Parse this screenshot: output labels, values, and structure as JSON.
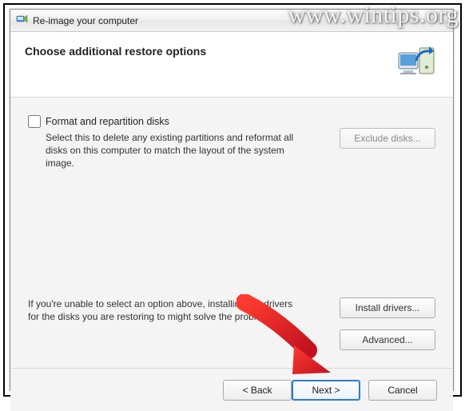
{
  "window": {
    "title": "Re-image your computer"
  },
  "header": {
    "heading": "Choose additional restore options"
  },
  "options": {
    "format_checkbox_label": "Format and repartition disks",
    "format_checkbox_checked": false,
    "format_description": "Select this to delete any existing partitions and reformat all disks on this computer to match the layout of the system image.",
    "exclude_button": "Exclude disks...",
    "exclude_button_enabled": false,
    "driver_help_text": "If you're unable to select an option above, installing the drivers for the disks you are restoring to might solve the problem.",
    "install_drivers_button": "Install drivers...",
    "advanced_button": "Advanced..."
  },
  "footer": {
    "back": "< Back",
    "next": "Next >",
    "cancel": "Cancel"
  },
  "watermark": "www.wintips.org",
  "icons": {
    "title_icon": "recovery-icon",
    "header_graphic": "computer-restore-icon"
  }
}
